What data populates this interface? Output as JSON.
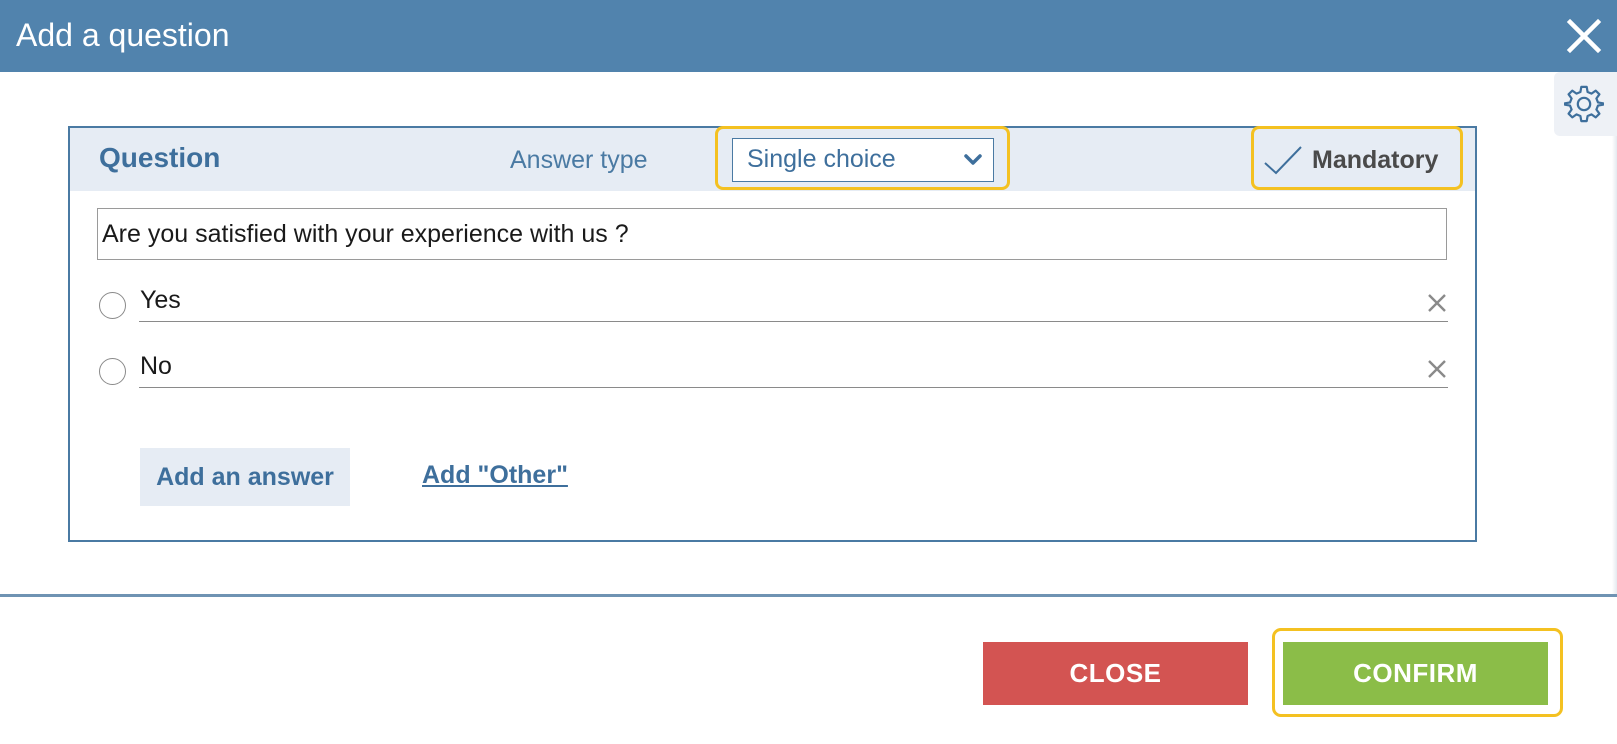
{
  "dialog": {
    "title": "Add a question",
    "close_icon": "close-icon",
    "settings_icon": "gear-icon"
  },
  "question_panel": {
    "question_label": "Question",
    "answer_type_label": "Answer type",
    "answer_type_value": "Single choice",
    "mandatory_label": "Mandatory",
    "mandatory_checked": true,
    "question_text": "Are you satisfied with your experience with us ?",
    "answers": [
      {
        "label": "Yes"
      },
      {
        "label": "No"
      }
    ],
    "add_answer_label": "Add an answer",
    "add_other_label": "Add \"Other\""
  },
  "footer": {
    "close_label": "CLOSE",
    "confirm_label": "CONFIRM"
  },
  "colors": {
    "title_bar": "#5183ad",
    "accent_text": "#3e6f9c",
    "panel_header": "#e6ecf4",
    "close_button": "#d35452",
    "confirm_button": "#8bbd48",
    "highlight": "#f4c121"
  }
}
